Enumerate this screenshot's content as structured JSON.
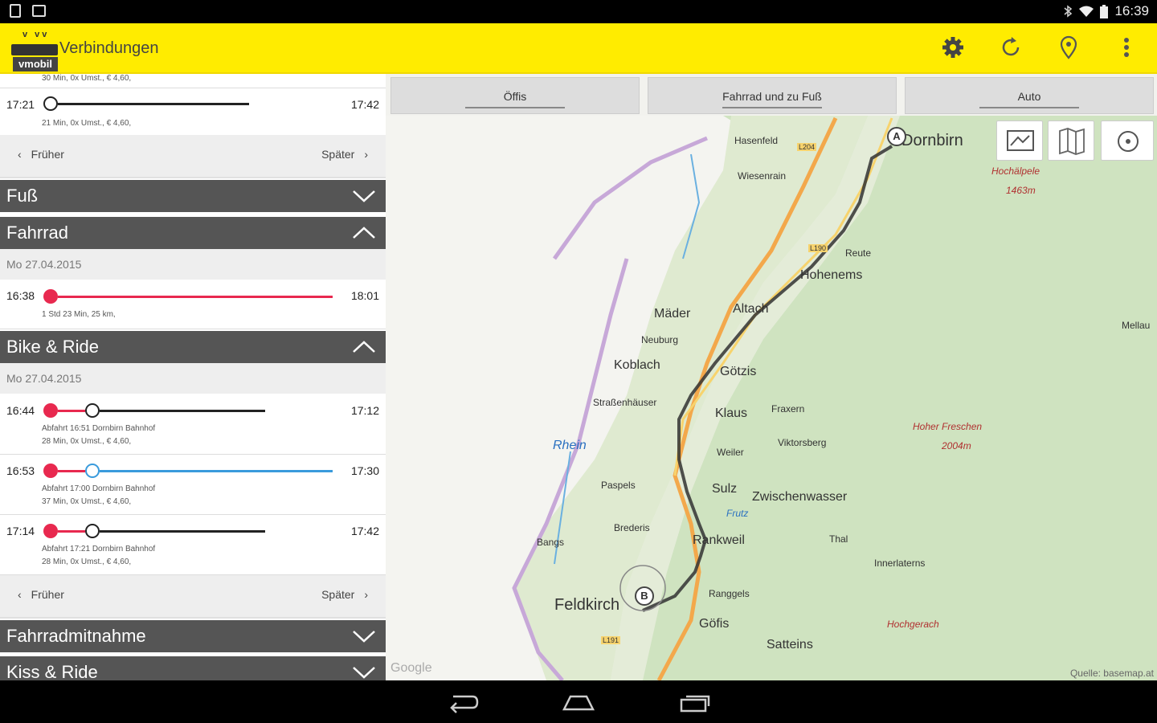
{
  "status": {
    "time": "16:39"
  },
  "appbar": {
    "title": "Verbindungen",
    "logo_text": "vmobil"
  },
  "top_connection": {
    "partial_info": "30 Min, 0x Umst., € 4,60,",
    "dep": "17:21",
    "arr": "17:42",
    "info": "21 Min, 0x Umst., € 4,60,"
  },
  "pager1": {
    "prev": "Früher",
    "next": "Später"
  },
  "sections": {
    "fuss": "Fuß",
    "fahrrad": "Fahrrad",
    "bike_ride": "Bike & Ride",
    "fahrradmitnahme": "Fahrradmitnahme",
    "kiss_ride": "Kiss & Ride"
  },
  "fahrrad": {
    "date": "Mo 27.04.2015",
    "dep": "16:38",
    "arr": "18:01",
    "info": "1 Std 23 Min, 25 km,"
  },
  "bike_ride": {
    "date": "Mo 27.04.2015",
    "items": [
      {
        "dep": "16:44",
        "arr": "17:12",
        "line1": "Abfahrt 16:51 Dornbirn Bahnhof",
        "line2": "28 Min, 0x Umst., € 4,60,"
      },
      {
        "dep": "16:53",
        "arr": "17:30",
        "line1": "Abfahrt 17:00 Dornbirn Bahnhof",
        "line2": "37 Min, 0x Umst., € 4,60,"
      },
      {
        "dep": "17:14",
        "arr": "17:42",
        "line1": "Abfahrt 17:21 Dornbirn Bahnhof",
        "line2": "28 Min, 0x Umst., € 4,60,"
      }
    ]
  },
  "pager2": {
    "prev": "Früher",
    "next": "Später"
  },
  "map": {
    "tabs": [
      "Öffis",
      "Fahrrad und zu Fuß",
      "Auto"
    ],
    "labels": {
      "dornbirn": "Dornbirn",
      "hohenems": "Hohenems",
      "altach": "Altach",
      "mader": "Mäder",
      "koblach": "Koblach",
      "gotzis": "Götzis",
      "klaus": "Klaus",
      "sulz": "Sulz",
      "zwischenwasser": "Zwischenwasser",
      "rankweil": "Rankweil",
      "feldkirch": "Feldkirch",
      "gofis": "Göfis",
      "satteins": "Satteins",
      "rhein": "Rhein",
      "hasenfeld": "Hasenfeld",
      "wiesenrain": "Wiesenrain",
      "reute": "Reute",
      "neuburg": "Neuburg",
      "strassenhauser": "Straßenhäuser",
      "fraxern": "Fraxern",
      "weiler": "Weiler",
      "viktorsberg": "Viktorsberg",
      "meiningen": "Paspels",
      "brederis": "Brederis",
      "bangs": "Bangs",
      "thal": "Thal",
      "innerlaterns": "Innerlaterns",
      "frutz": "Frutz",
      "ranggels": "Ranggels",
      "mellau": "Mellau",
      "hochalpele": "Hochälpele",
      "hochalpele_h": "1463m",
      "hoher_freschen": "Hoher Freschen",
      "hoher_freschen_h": "2004m",
      "hochgerach": "Hochgerach",
      "rankweil_l": "L190",
      "l204": "L204",
      "l190": "L190",
      "l191": "L191",
      "marker_a": "A",
      "marker_b": "B",
      "google": "Google",
      "source": "Quelle: basemap.at"
    }
  },
  "colors": {
    "accent": "#ffec00",
    "bike": "#e8294f",
    "train": "#3a9bdc",
    "section": "#555555"
  }
}
